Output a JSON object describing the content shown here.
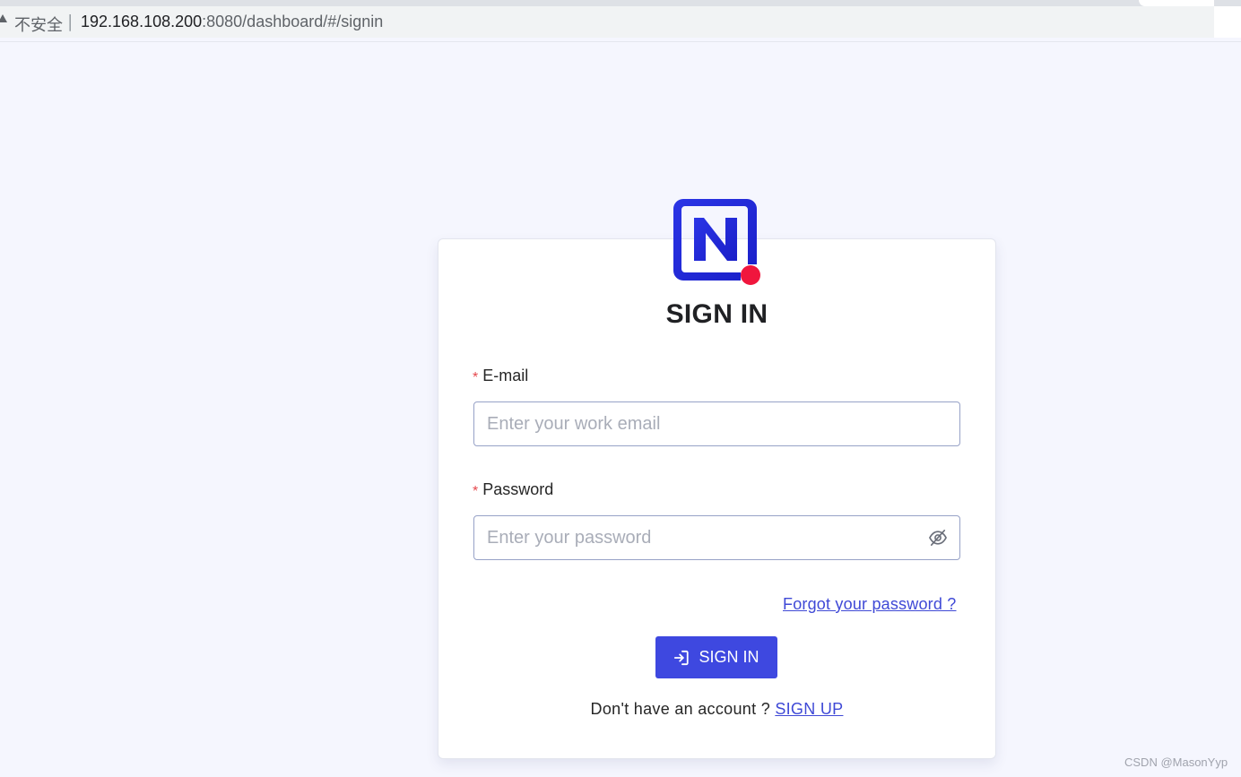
{
  "browser": {
    "security_label": "不安全",
    "separator": "|",
    "url_host": "192.168.108.200",
    "url_rest": ":8080/dashboard/#/signin"
  },
  "icons": {
    "security": "warning-triangle-icon",
    "logo": "nocodb-logo-icon",
    "password_toggle": "eye-off-icon",
    "signin": "sign-in-icon"
  },
  "colors": {
    "accent": "#3e48e0",
    "logo_blue": "#1f2ad8",
    "logo_dot": "#f0163d",
    "required": "#e5484d",
    "link": "#3f49d6",
    "page_bg": "#f5f6fe"
  },
  "signin_form": {
    "title": "SIGN IN",
    "required_mark": "*",
    "email_label": "E-mail",
    "email_placeholder": "Enter your work email",
    "email_value": "",
    "password_label": "Password",
    "password_placeholder": "Enter your password",
    "password_value": "",
    "forgot_link": "Forgot your password ?",
    "submit_label": "SIGN IN",
    "no_account_text": "Don't have an account ?",
    "signup_link": "SIGN UP"
  },
  "watermark": "CSDN @MasonYyp"
}
